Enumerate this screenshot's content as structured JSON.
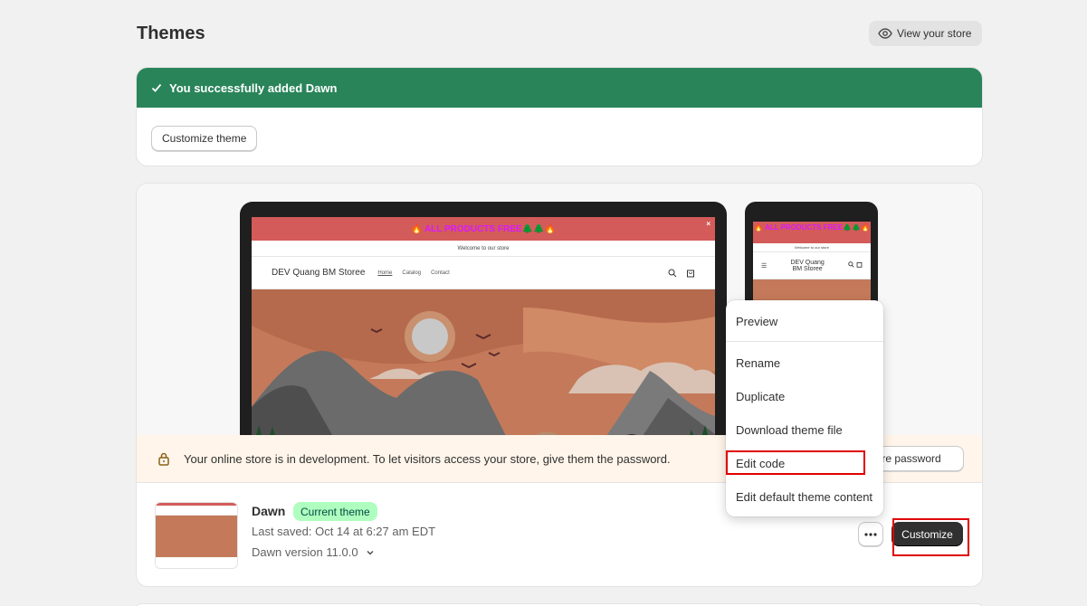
{
  "header": {
    "title": "Themes",
    "view_store_label": "View your store"
  },
  "success": {
    "message": "You successfully added Dawn",
    "customize_button": "Customize theme"
  },
  "preview": {
    "announcement": "🔥 ALL PRODUCTS FREE🌲🌲🔥",
    "close_symbol": "×",
    "welcome": "Welcome to our store",
    "store_name": "DEV Quang BM Storee",
    "nav": [
      "Home",
      "Catalog",
      "Contact"
    ]
  },
  "dev_notice": {
    "message": "Your online store is in development. To let visitors access your store, give them the password.",
    "button": "Store password"
  },
  "theme": {
    "name": "Dawn",
    "badge": "Current theme",
    "last_saved": "Last saved: Oct 14 at 6:27 am EDT",
    "version": "Dawn version 11.0.0",
    "customize_label": "Customize"
  },
  "menu": {
    "items": [
      "Preview",
      "Rename",
      "Duplicate",
      "Download theme file",
      "Edit code",
      "Edit default theme content"
    ]
  },
  "colors": {
    "success_green": "#29845a",
    "badge_green": "#affebf",
    "warning_bg": "#fff5ea",
    "primary_button": "#303030",
    "highlight_red": "#e00000"
  }
}
